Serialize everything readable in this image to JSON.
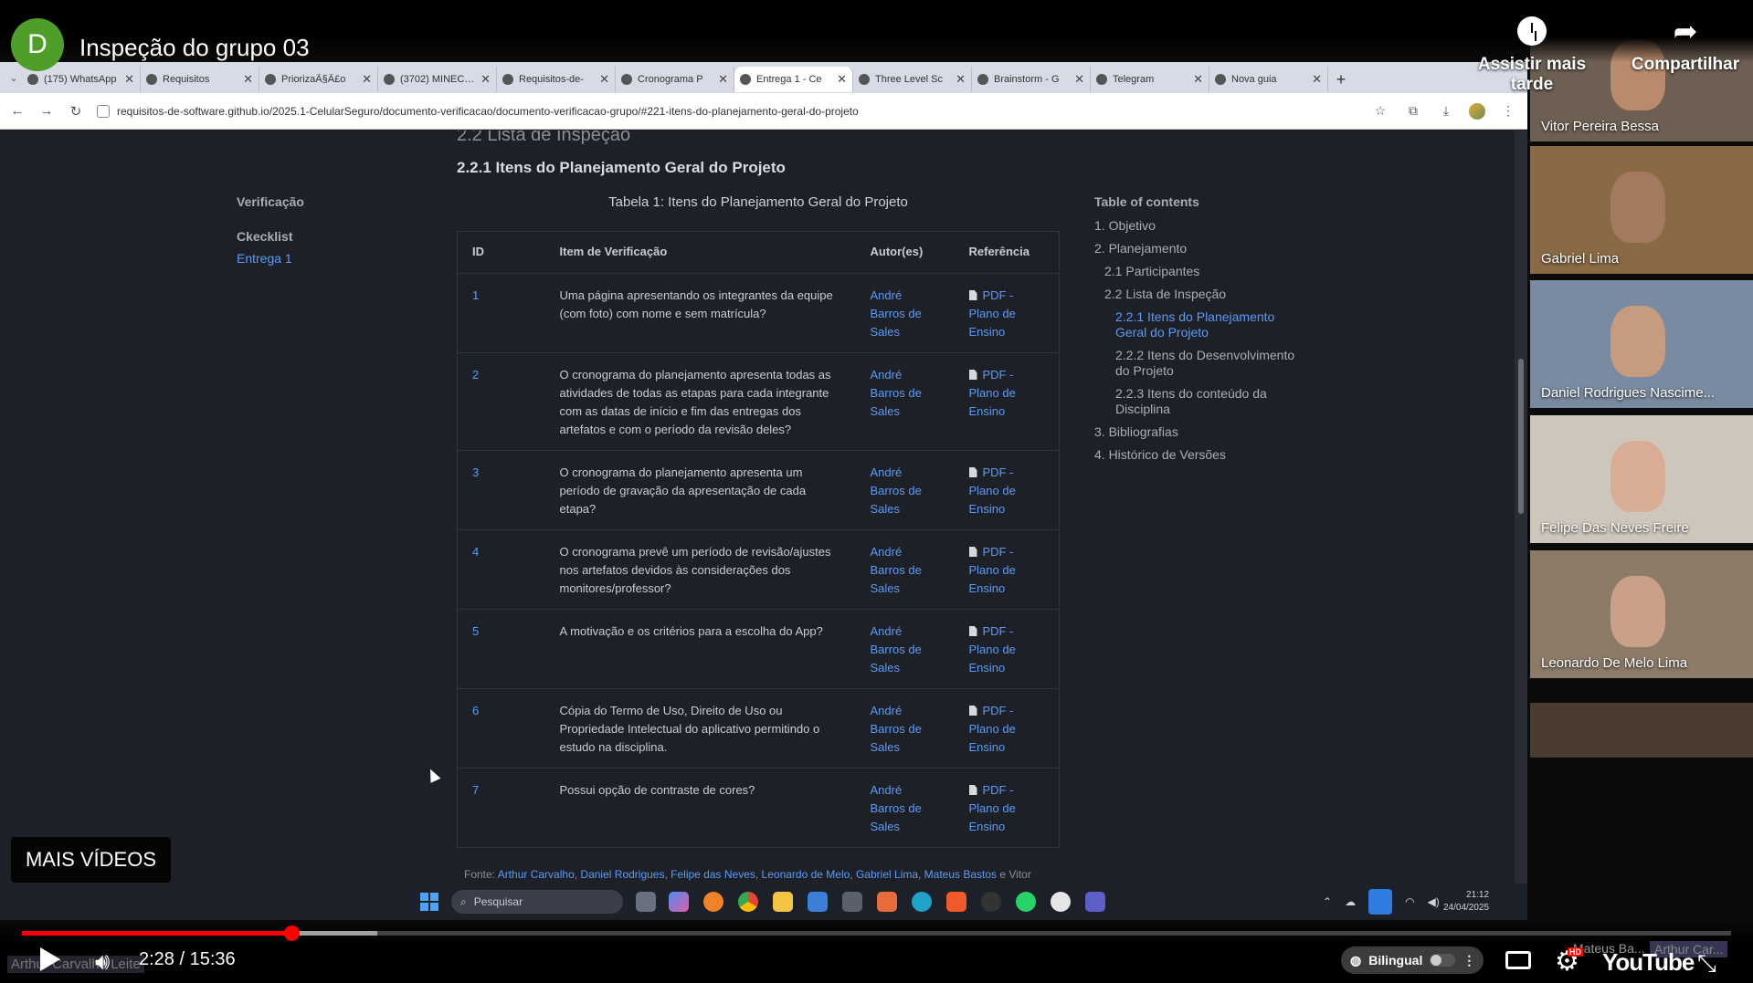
{
  "youtube": {
    "channel_initial": "D",
    "video_title": "Inspeção do grupo 03",
    "watch_later_label": "Assistir mais tarde",
    "share_label": "Compartilhar",
    "more_videos_label": "MAIS VÍDEOS",
    "timecode": "2:28 / 15:36",
    "progress_played_fraction": 0.1575,
    "progress_buffered_fraction": 0.208,
    "bilingual_label": "Bilingual",
    "hd_badge": "HD",
    "logo_text": "YouTube",
    "colors": {
      "progress": "#ff0000",
      "avatar": "#4f9e2a"
    }
  },
  "browser": {
    "tabs": [
      {
        "label": "(175) WhatsApp",
        "icon": "whatsapp-icon",
        "active": false
      },
      {
        "label": "Requisitos",
        "icon": "globe-icon",
        "active": false
      },
      {
        "label": "PriorizaÃ§Ã£o",
        "icon": "globe-icon",
        "active": false
      },
      {
        "label": "(3702) MINECRA",
        "icon": "youtube-icon",
        "active": false
      },
      {
        "label": "Requisitos-de-",
        "icon": "github-icon",
        "active": false
      },
      {
        "label": "Cronograma P",
        "icon": "github-icon",
        "active": false
      },
      {
        "label": "Entrega 1 - Ce",
        "icon": "github-icon",
        "active": true
      },
      {
        "label": "Three Level Sc",
        "icon": "notion-icon",
        "active": false
      },
      {
        "label": "Brainstorm - G",
        "icon": "doc-icon",
        "active": false
      },
      {
        "label": "Telegram",
        "icon": "telegram-icon",
        "active": false
      },
      {
        "label": "Nova guia",
        "icon": "chrome-icon",
        "active": false
      }
    ],
    "url": "requisitos-de-software.github.io/2025.1-CelularSeguro/documento-verificacao/documento-verificacao-grupo/#221-itens-do-planejamento-geral-do-projeto"
  },
  "page": {
    "section_heading": "2.2 Lista de Inspeção",
    "subsection_title": "2.2.1 Itens do Planejamento Geral do Projeto",
    "table_caption": "Tabela 1: Itens do Planejamento Geral do Projeto",
    "leftnav": {
      "title": "Verificação",
      "group": "Ckecklist",
      "link": "Entrega 1"
    },
    "table": {
      "headers": [
        "ID",
        "Item de Verificação",
        "Autor(es)",
        "Referência"
      ],
      "rows": [
        {
          "id": "1",
          "item": "Uma página apresentando os integrantes da equipe (com foto) com nome e sem matrícula?",
          "author": "André Barros de Sales",
          "ref": "PDF - Plano de Ensino"
        },
        {
          "id": "2",
          "item": "O cronograma do planejamento apresenta todas as atividades de todas as etapas para cada integrante com as datas de início e fim das entregas dos artefatos e com o período da revisão deles?",
          "author": "André Barros de Sales",
          "ref": "PDF - Plano de Ensino"
        },
        {
          "id": "3",
          "item": "O cronograma do planejamento apresenta um período de gravação da apresentação de cada etapa?",
          "author": "André Barros de Sales",
          "ref": "PDF - Plano de Ensino"
        },
        {
          "id": "4",
          "item": "O cronograma prevê um período de revisão/ajustes nos artefatos devidos às considerações dos monitores/professor?",
          "author": "André Barros de Sales",
          "ref": "PDF - Plano de Ensino"
        },
        {
          "id": "5",
          "item": "A motivação e os critérios para a escolha do App?",
          "author": "André Barros de Sales",
          "ref": "PDF - Plano de Ensino"
        },
        {
          "id": "6",
          "item": "Cópia do Termo de Uso, Direito de Uso ou Propriedade Intelectual do aplicativo permitindo o estudo na disciplina.",
          "author": "André Barros de Sales",
          "ref": "PDF - Plano de Ensino"
        },
        {
          "id": "7",
          "item": "Possui opção de contraste de cores?",
          "author": "André Barros de Sales",
          "ref": "PDF - Plano de Ensino"
        }
      ]
    },
    "toc": {
      "title": "Table of contents",
      "items": [
        {
          "label": "1. Objetivo",
          "level": 1,
          "active": false
        },
        {
          "label": "2. Planejamento",
          "level": 1,
          "active": false
        },
        {
          "label": "2.1 Participantes",
          "level": 2,
          "active": false
        },
        {
          "label": "2.2 Lista de Inspeção",
          "level": 2,
          "active": false
        },
        {
          "label": "2.2.1 Itens do Planejamento Geral do Projeto",
          "level": 3,
          "active": true
        },
        {
          "label": "2.2.2 Itens do Desenvolvimento do Projeto",
          "level": 3,
          "active": false
        },
        {
          "label": "2.2.3 Itens do conteúdo da Disciplina",
          "level": 3,
          "active": false
        },
        {
          "label": "3. Bibliografias",
          "level": 1,
          "active": false
        },
        {
          "label": "4. Histórico de Versões",
          "level": 1,
          "active": false
        }
      ]
    },
    "source_line": {
      "prefix": "Fonte: ",
      "authors": [
        "Arthur Carvalho",
        "Daniel Rodrigues",
        "Felipe das Neves",
        "Leonardo de Melo",
        "Gabriel Lima",
        "Mateus Bastos"
      ],
      "suffix": "e Vitor"
    }
  },
  "taskbar": {
    "search_placeholder": "Pesquisar",
    "time": "21:12",
    "date": "24/04/2025"
  },
  "participants": [
    {
      "name": "Vitor Pereira Bessa",
      "scene": "#6d5f52",
      "face": "#b98a6c"
    },
    {
      "name": "Gabriel Lima",
      "scene": "#8a6a45",
      "face": "#a47a5e"
    },
    {
      "name": "Daniel Rodrigues Nascime...",
      "scene": "#7a8aa0",
      "face": "#c79b7e"
    },
    {
      "name": "Felipe Das Neves Freire",
      "scene": "#cfc6bb",
      "face": "#d8ad93"
    },
    {
      "name": "Leonardo De Melo Lima",
      "scene": "#8c7b67",
      "face": "#caa188"
    }
  ],
  "overlays": {
    "bottom_left_name": "Arthur Carvalho Leite",
    "bottom_right_name_1": "Mateus Ba...",
    "bottom_right_name_2": "Arthur Car..."
  }
}
